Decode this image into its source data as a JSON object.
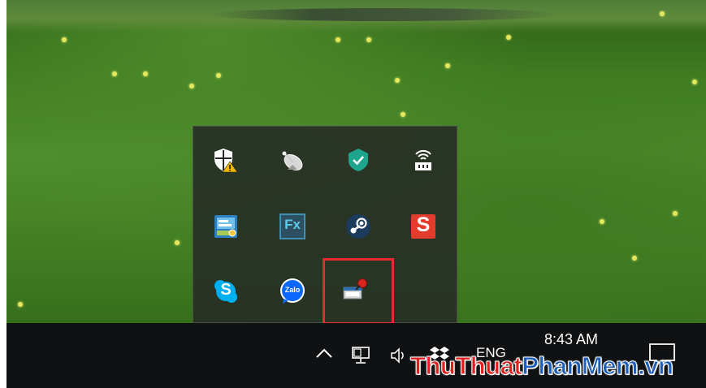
{
  "desktop": {
    "wallpaper": "green-meadow-with-yellow-flowers"
  },
  "tray_popup": {
    "rows": [
      [
        "windows-security-icon",
        "satellite-dish-icon",
        "kaspersky-shield-icon",
        "network-lock-icon"
      ],
      [
        "unikey-icon",
        "fx-icon",
        "steam-icon",
        "sticky-s-icon"
      ],
      [
        "skype-icon",
        "zalo-icon",
        "unknown-app-icon"
      ]
    ],
    "zalo_label": "Zalo",
    "fx_label": "Fx",
    "skype_label": "S",
    "s_label": "S"
  },
  "taskbar": {
    "time": "8:43 AM",
    "language": "ENG",
    "icons": [
      "chevron-up-icon",
      "network-icon",
      "volume-icon",
      "dropbox-icon",
      "notification-icon"
    ]
  },
  "watermark": {
    "part1": "Thu",
    "part2": "Thuat",
    "part3": "PhanMem",
    "part4": ".vn"
  },
  "colors": {
    "highlight": "#e8292e",
    "taskbar": "#101112",
    "popup": "#262a24"
  }
}
